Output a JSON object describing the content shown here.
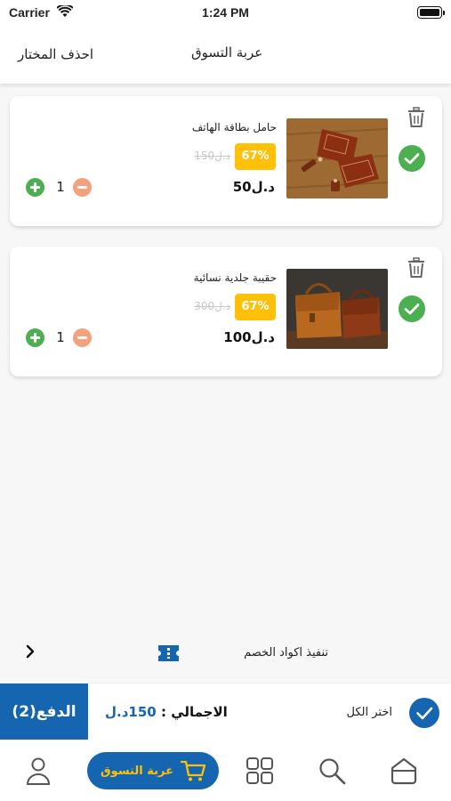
{
  "status_bar": {
    "carrier": "Carrier",
    "time": "1:24 PM"
  },
  "header": {
    "title": "عربة التسوق",
    "delete_selected": "احذف المختار"
  },
  "cart_items": [
    {
      "name": "حامل بطاقة الهاتف",
      "discount": "67%",
      "old_price": "150د.ل",
      "price": "50د.ل",
      "quantity": "1",
      "selected": true,
      "image": "brown leather wallet and card holder on wooden table"
    },
    {
      "name": "حقيبة جلدية نسائية",
      "discount": "67%",
      "old_price": "300د.ل",
      "price": "100د.ل",
      "quantity": "1",
      "selected": true,
      "image": "two brown leather messenger bags"
    }
  ],
  "coupon": {
    "label": "تنفيذ اكواد الخصم"
  },
  "checkout": {
    "pay_label": "الدفع(2)",
    "total_label": "الاجمالي :",
    "total_value": "150د.ل",
    "select_all_label": "اختر الكل",
    "select_all_checked": true
  },
  "bottom_nav": {
    "cart_label": "عربة التسوق",
    "items": [
      "profile-icon",
      "cart-icon",
      "categories-icon",
      "search-icon",
      "home-icon"
    ]
  },
  "colors": {
    "primary": "#1565b0",
    "accent": "#ffc107",
    "success": "#4caf50",
    "minus": "#f3a27b"
  }
}
